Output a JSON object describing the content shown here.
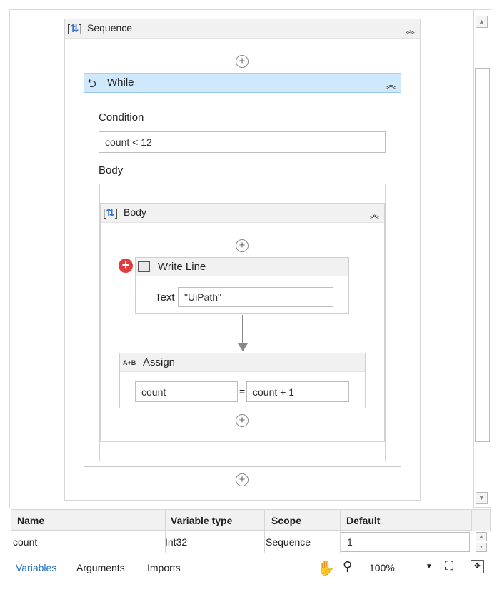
{
  "sequence": {
    "title": "Sequence"
  },
  "while": {
    "title": "While",
    "condition_label": "Condition",
    "condition_value": "count < 12",
    "body_label": "Body"
  },
  "body": {
    "title": "Body"
  },
  "write_line": {
    "title": "Write Line",
    "text_label": "Text",
    "text_value": "\"UiPath\""
  },
  "assign": {
    "icon_text": "A+B",
    "title": "Assign",
    "to_value": "count",
    "equals": "=",
    "value": "count + 1"
  },
  "variables_panel": {
    "columns": [
      "Name",
      "Variable type",
      "Scope",
      "Default"
    ],
    "rows": [
      {
        "name": "count",
        "type": "Int32",
        "scope": "Sequence",
        "default": "1"
      }
    ]
  },
  "bottom_bar": {
    "tabs": [
      "Variables",
      "Arguments",
      "Imports"
    ],
    "active_tab": "Variables",
    "zoom": "100%"
  },
  "colors": {
    "accent": "#1f6fbf",
    "selected_header": "#cfe8fb",
    "error": "#e23b3b"
  },
  "icons": [
    "sequence-icon",
    "while-icon",
    "collapse-icon",
    "add-activity-icon",
    "error-icon",
    "write-line-icon",
    "assign-icon",
    "hand-icon",
    "zoom-icon",
    "fit-screen-icon",
    "overview-icon"
  ]
}
